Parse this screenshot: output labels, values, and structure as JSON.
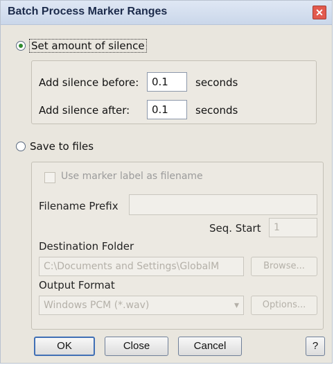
{
  "window": {
    "title": "Batch Process Marker Ranges",
    "close_glyph": "✕"
  },
  "silence": {
    "radio_label": "Set amount of silence",
    "before_label": "Add silence before:",
    "before_value": "0.1",
    "after_label": "Add silence after:",
    "after_value": "0.1",
    "unit": "seconds"
  },
  "files": {
    "radio_label": "Save to files",
    "checkbox_label": "Use marker label as filename",
    "prefix_label": "Filename Prefix",
    "prefix_value": "",
    "seq_label": "Seq. Start",
    "seq_value": "1",
    "dest_label": "Destination Folder",
    "dest_value": "C:\\Documents and Settings\\GlobalM",
    "browse_label": "Browse...",
    "format_label": "Output Format",
    "format_value": "Windows PCM (*.wav)",
    "options_label": "Options..."
  },
  "buttons": {
    "ok": "OK",
    "close": "Close",
    "cancel": "Cancel",
    "help": "?"
  }
}
